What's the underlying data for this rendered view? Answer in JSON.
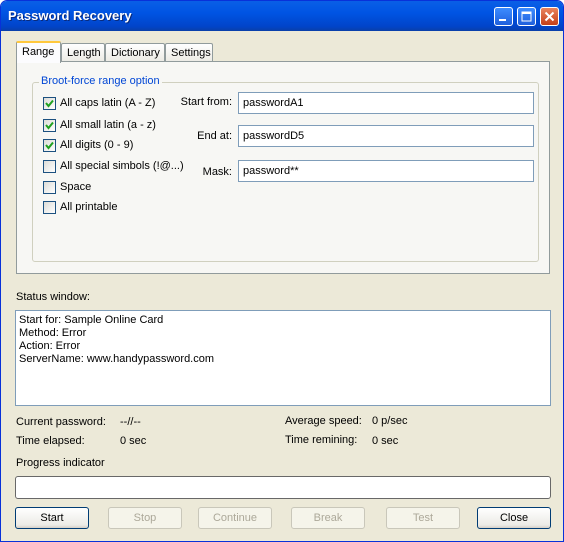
{
  "window": {
    "title": "Password Recovery"
  },
  "tabs": [
    {
      "label": "Range",
      "active": true
    },
    {
      "label": "Length",
      "active": false
    },
    {
      "label": "Dictionary",
      "active": false
    },
    {
      "label": "Settings",
      "active": false
    }
  ],
  "range": {
    "group_title": "Broot-force range option",
    "checkboxes": [
      {
        "label": "All caps latin (A - Z)",
        "checked": true
      },
      {
        "label": "All small latin (a - z)",
        "checked": true
      },
      {
        "label": "All digits (0 - 9)",
        "checked": true
      },
      {
        "label": "All special simbols (!@...)",
        "checked": false
      },
      {
        "label": "Space",
        "checked": false
      },
      {
        "label": "All printable",
        "checked": false
      }
    ],
    "start_from": {
      "label": "Start from:",
      "value": "passwordA1"
    },
    "end_at": {
      "label": "End at:",
      "value": "passwordD5"
    },
    "mask": {
      "label": "Mask:",
      "value": "password**"
    }
  },
  "status": {
    "label": "Status window:",
    "lines": [
      "Start for: Sample Online Card",
      "Method: Error",
      "Action: Error",
      "ServerName: www.handypassword.com"
    ]
  },
  "stats": {
    "current_password": {
      "label": "Current password:",
      "value": "--//--"
    },
    "time_elapsed": {
      "label": "Time elapsed:",
      "value": "0 sec"
    },
    "average_speed": {
      "label": "Average speed:",
      "value": "0 p/sec"
    },
    "time_remaining": {
      "label": "Time remining:",
      "value": "0 sec"
    }
  },
  "progress": {
    "label": "Progress indicator",
    "value": 0
  },
  "buttons": {
    "start": "Start",
    "stop": "Stop",
    "continue": "Continue",
    "break": "Break",
    "test": "Test",
    "close": "Close"
  }
}
